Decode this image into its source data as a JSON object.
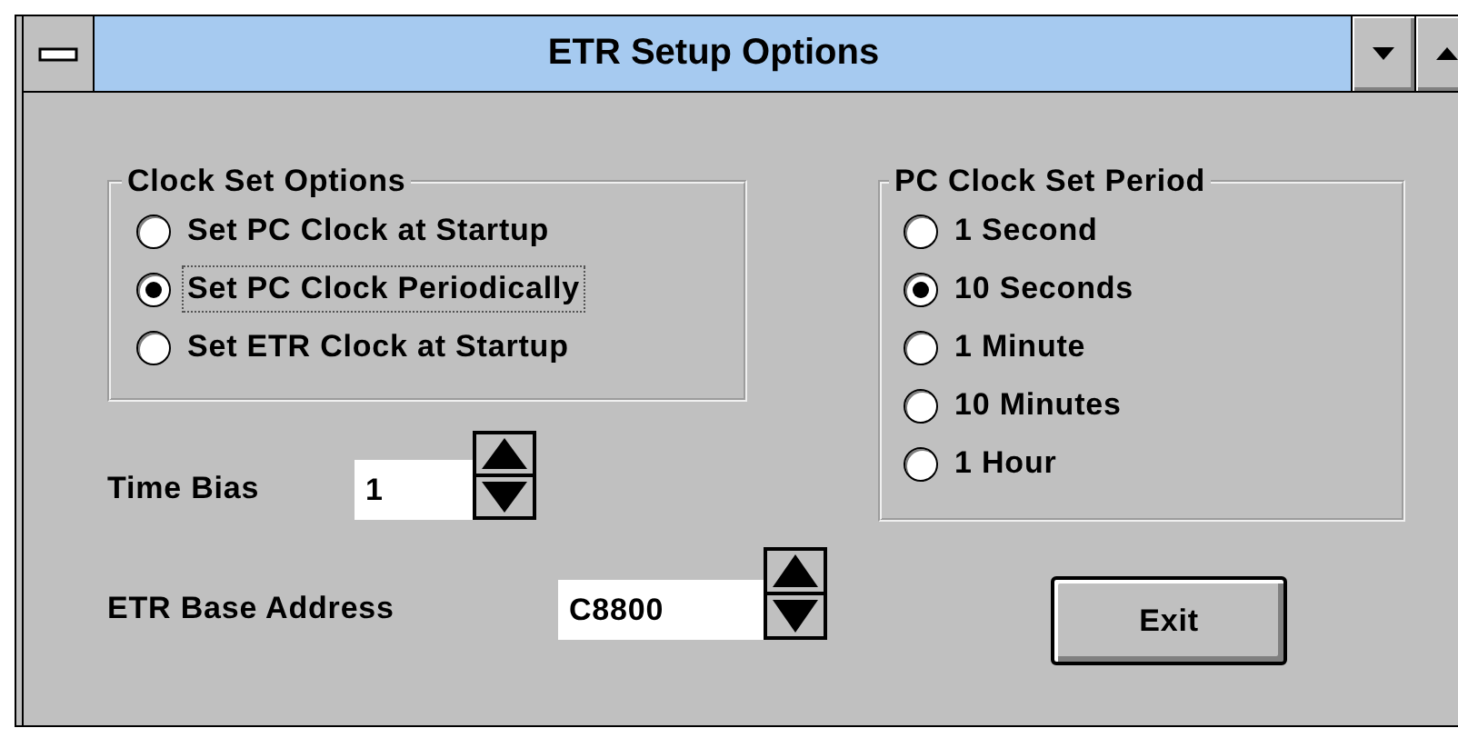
{
  "window": {
    "title": "ETR Setup Options"
  },
  "clock_set_options": {
    "label": "Clock Set Options",
    "options": [
      {
        "label": "Set PC Clock at Startup",
        "selected": false,
        "focused": false
      },
      {
        "label": "Set PC Clock Periodically",
        "selected": true,
        "focused": true
      },
      {
        "label": "Set ETR Clock at Startup",
        "selected": false,
        "focused": false
      }
    ]
  },
  "time_bias": {
    "label": "Time Bias",
    "value": "1"
  },
  "base_address": {
    "label": "ETR Base Address",
    "value": "C8800"
  },
  "pc_clock_set_period": {
    "label": "PC Clock Set Period",
    "options": [
      {
        "label": "1 Second",
        "selected": false
      },
      {
        "label": "10 Seconds",
        "selected": true
      },
      {
        "label": "1 Minute",
        "selected": false
      },
      {
        "label": "10 Minutes",
        "selected": false
      },
      {
        "label": "1 Hour",
        "selected": false
      }
    ]
  },
  "buttons": [
    {
      "label": "Exit"
    }
  ]
}
